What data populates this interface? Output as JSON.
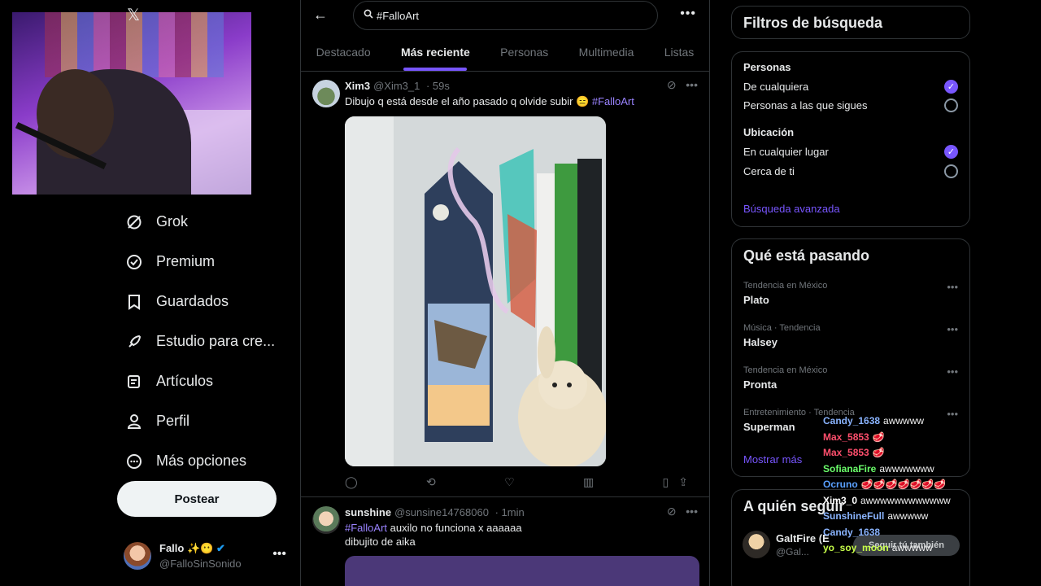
{
  "nav": {
    "items": [
      {
        "label": "Grok",
        "icon": "grok-icon"
      },
      {
        "label": "Premium",
        "icon": "premium-icon"
      },
      {
        "label": "Guardados",
        "icon": "bookmark-icon"
      },
      {
        "label": "Estudio para cre...",
        "icon": "rocket-icon"
      },
      {
        "label": "Artículos",
        "icon": "article-icon"
      },
      {
        "label": "Perfil",
        "icon": "person-icon"
      },
      {
        "label": "Más opciones",
        "icon": "more-circle-icon"
      }
    ],
    "post_label": "Postear",
    "account_name": "Fallo ✨😶",
    "account_handle": "@FalloSinSonido"
  },
  "search": {
    "query": "#FalloArt"
  },
  "tabs": [
    "Destacado",
    "Más reciente",
    "Personas",
    "Multimedia",
    "Listas"
  ],
  "active_tab": "Más reciente",
  "tweets": [
    {
      "name": "Xim3",
      "handle": "@Xim3_1",
      "time": "· 59s",
      "text": "Dibujo q está desde el año pasado q olvide subir 😑",
      "hashtag": "#FalloArt"
    },
    {
      "name": "sunshine",
      "handle": "@sunsine14768060",
      "time": "· 1min",
      "hashtag": "#FalloArt",
      "text_line1": " auxilo no funciona x aaaaaa",
      "text_line2": "dibujito de aika"
    }
  ],
  "filters": {
    "title": "Filtros de búsqueda",
    "people_head": "Personas",
    "people_any": "De cualquiera",
    "people_follow": "Personas a las que sigues",
    "location_head": "Ubicación",
    "location_any": "En cualquier lugar",
    "location_near": "Cerca de ti",
    "advanced": "Búsqueda avanzada"
  },
  "trends": {
    "title": "Qué está pasando",
    "items": [
      {
        "category": "Tendencia en México",
        "name": "Plato"
      },
      {
        "category": "Música · Tendencia",
        "name": "Halsey"
      },
      {
        "category": "Tendencia en México",
        "name": "Pronta"
      },
      {
        "category": "Entretenimiento · Tendencia",
        "name": "Superman"
      }
    ],
    "show_more": "Mostrar más"
  },
  "who_to_follow": {
    "title": "A quién seguir",
    "name": "GaltFire (E",
    "handle": "@Gal...",
    "follow_label": "Seguir tú también"
  },
  "chat": [
    {
      "user": "Candy_1638",
      "msg": "awwwww",
      "color": "#8ab4ff"
    },
    {
      "user": "Max_5853",
      "msg": "🥩",
      "color": "#ff4f6d"
    },
    {
      "user": "Max_5853",
      "msg": "🥩",
      "color": "#ff4f6d"
    },
    {
      "user": "SofianaFire",
      "msg": "awwwwwww",
      "color": "#6bff6b"
    },
    {
      "user": "Ocruno",
      "msg": "🥩🥩🥩🥩🥩🥩🥩",
      "color": "#5aa0ff"
    },
    {
      "user": "Xim3_0",
      "msg": "awwwwwwwwwwww",
      "color": "#ffffff"
    },
    {
      "user": "SunshineFull",
      "msg": "awwwww",
      "color": "#8ab4ff"
    },
    {
      "user": "Candy_1638",
      "msg": "",
      "color": "#8ab4ff"
    },
    {
      "user": "yo_soy_moon",
      "msg": "awwwww",
      "color": "#c8ff4a"
    }
  ]
}
